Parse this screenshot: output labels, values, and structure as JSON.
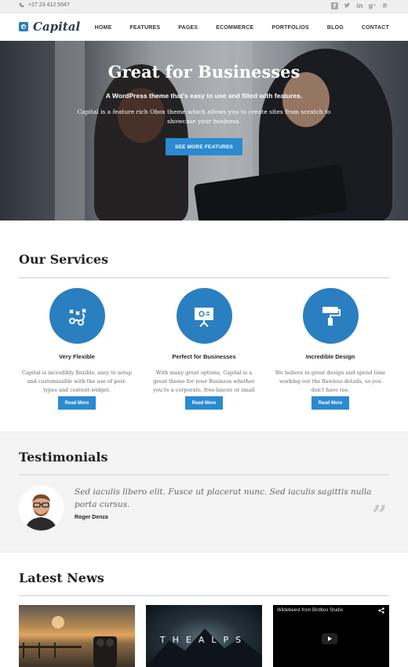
{
  "topbar": {
    "phone": "+27 23 412 5547",
    "socials": [
      "facebook-icon",
      "twitter-icon",
      "linkedin-icon",
      "google-plus-icon",
      "pinterest-icon"
    ]
  },
  "header": {
    "logo_text": "Capital",
    "nav": [
      "HOME",
      "FEATURES",
      "PAGES",
      "ECOMMERCE",
      "PORTFOLIOS",
      "BLOG",
      "CONTACT"
    ]
  },
  "hero": {
    "title": "Great for Businesses",
    "subtitle": "A WordPress theme that's easy to use and filled with features.",
    "description": "Capital is a feature rich Obox theme which allows you to create sites from scratch to showcase your business.",
    "button": "SEE MORE FEATURES"
  },
  "services": {
    "heading": "Our Services",
    "items": [
      {
        "icon": "strategy-icon",
        "title": "Very Flexible",
        "description": "Capital is incredibly flexible, easy to setup and customizable with the use of post-types and content-widget.",
        "button": "Read More"
      },
      {
        "icon": "presentation-icon",
        "title": "Perfect for Businesses",
        "description": "With many great options, Capital is a great theme for your Business whether you're a corporate, free-lancer or small business.",
        "button": "Read More"
      },
      {
        "icon": "paint-roller-icon",
        "title": "Incredible Design",
        "description": "We believe in great design and spend time working out the flawless details, so you don't have too.",
        "button": "Read More"
      }
    ]
  },
  "testimonials": {
    "heading": "Testimonials",
    "quote": "Sed iaculis libero elit. Fusce ut placerat nunc. Sed iaculis sagittis nulla porta cursus.",
    "author": "Roger Denza",
    "quote_mark": "”"
  },
  "news": {
    "heading": "Latest News",
    "items": [
      {
        "type": "image",
        "caption": ""
      },
      {
        "type": "image",
        "caption": "THEALPS"
      },
      {
        "type": "video",
        "caption": "Wildebeest from Birdbox Studio"
      }
    ]
  },
  "colors": {
    "accent": "#2a7fc1",
    "button": "#2a8bd0"
  }
}
